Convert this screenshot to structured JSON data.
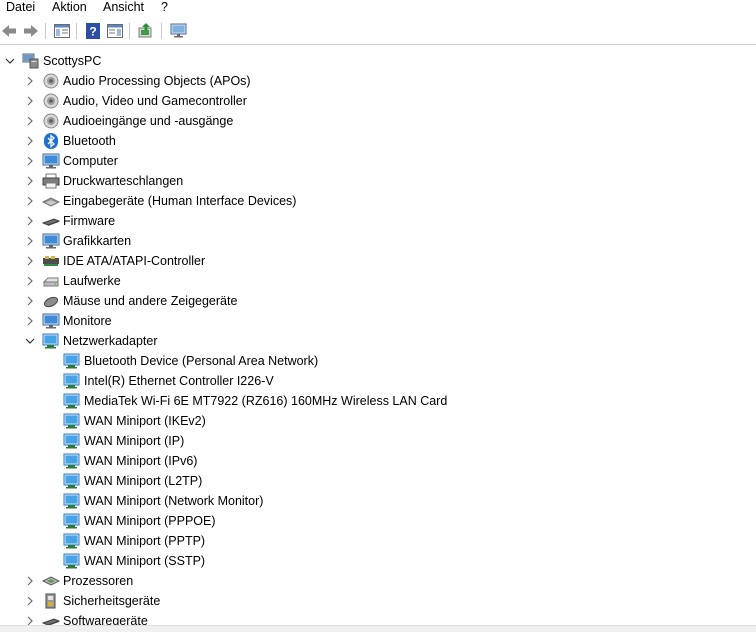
{
  "menu": [
    "Datei",
    "Aktion",
    "Ansicht",
    "?"
  ],
  "toolbar": {
    "icons": [
      "back-arrow-icon",
      "forward-arrow-icon",
      "console-tree-icon",
      "help-icon",
      "properties-pane-icon",
      "update-driver-icon",
      "scan-hardware-icon"
    ]
  },
  "tree": {
    "root": "ScottysPC",
    "categories": [
      {
        "label": "Audio Processing Objects (APOs)",
        "icon": "speaker-icon",
        "expanded": false
      },
      {
        "label": "Audio, Video und Gamecontroller",
        "icon": "speaker-icon",
        "expanded": false
      },
      {
        "label": "Audioeingänge und -ausgänge",
        "icon": "speaker-icon",
        "expanded": false
      },
      {
        "label": "Bluetooth",
        "icon": "bluetooth-icon",
        "expanded": false
      },
      {
        "label": "Computer",
        "icon": "monitor-icon",
        "expanded": false
      },
      {
        "label": "Druckwarteschlangen",
        "icon": "printer-icon",
        "expanded": false
      },
      {
        "label": "Eingabegeräte (Human Interface Devices)",
        "icon": "hid-icon",
        "expanded": false
      },
      {
        "label": "Firmware",
        "icon": "chip-icon",
        "expanded": false
      },
      {
        "label": "Grafikkarten",
        "icon": "monitor-icon",
        "expanded": false
      },
      {
        "label": "IDE ATA/ATAPI-Controller",
        "icon": "controller-icon",
        "expanded": false
      },
      {
        "label": "Laufwerke",
        "icon": "drive-icon",
        "expanded": false
      },
      {
        "label": "Mäuse und andere Zeigegeräte",
        "icon": "mouse-icon",
        "expanded": false
      },
      {
        "label": "Monitore",
        "icon": "monitor-icon",
        "expanded": false
      },
      {
        "label": "Netzwerkadapter",
        "icon": "network-adapter-icon",
        "expanded": true,
        "children": [
          "Bluetooth Device (Personal Area Network)",
          "Intel(R) Ethernet Controller I226-V",
          "MediaTek Wi-Fi 6E MT7922 (RZ616) 160MHz Wireless LAN Card",
          "WAN Miniport (IKEv2)",
          "WAN Miniport (IP)",
          "WAN Miniport (IPv6)",
          "WAN Miniport (L2TP)",
          "WAN Miniport (Network Monitor)",
          "WAN Miniport (PPPOE)",
          "WAN Miniport (PPTP)",
          "WAN Miniport (SSTP)"
        ]
      },
      {
        "label": "Prozessoren",
        "icon": "processor-icon",
        "expanded": false
      },
      {
        "label": "Sicherheitsgeräte",
        "icon": "security-device-icon",
        "expanded": false
      },
      {
        "label": "Softwaregeräte",
        "icon": "chip-icon",
        "expanded": false
      }
    ]
  }
}
